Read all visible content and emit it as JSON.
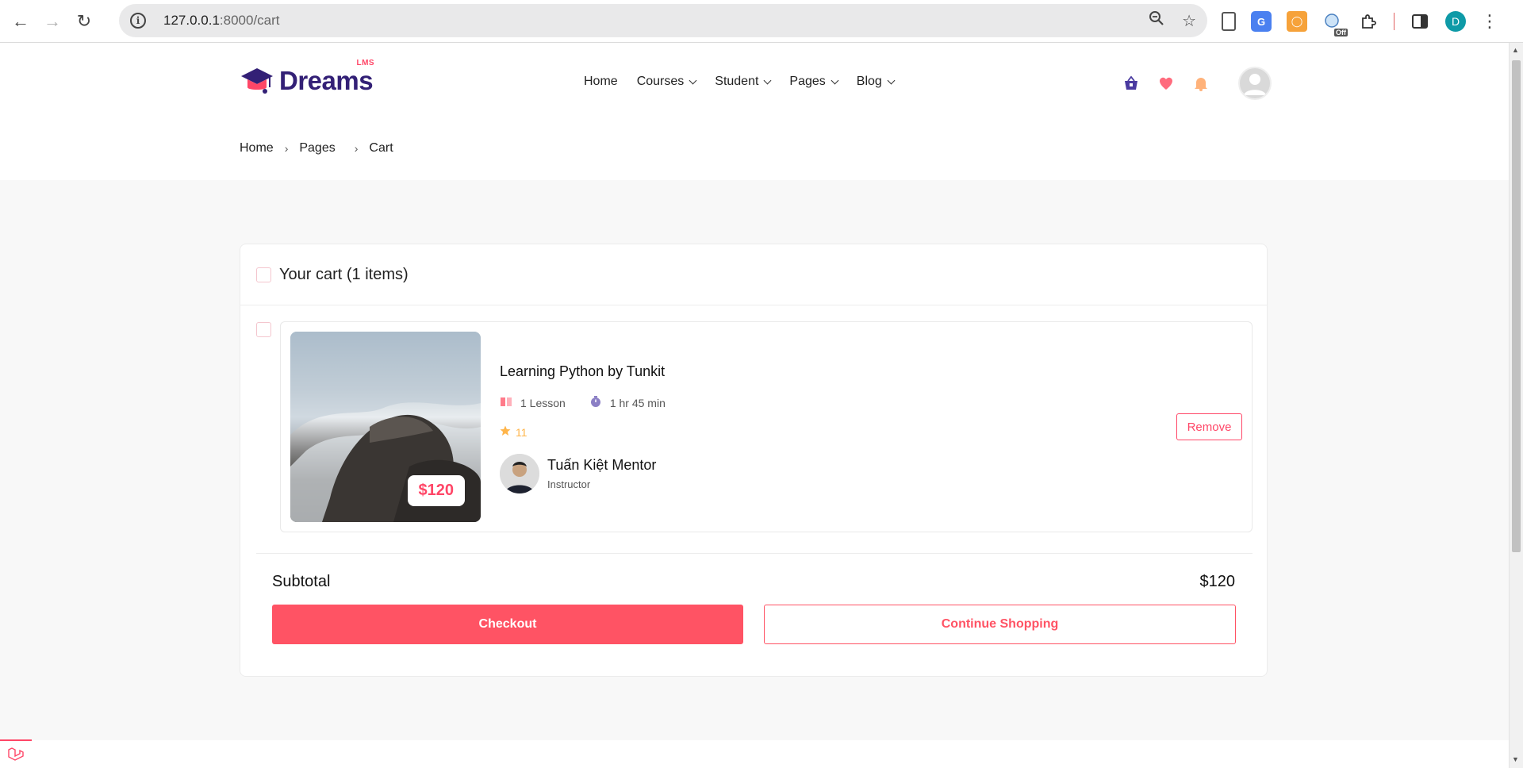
{
  "browser": {
    "url_host": "127.0.0.1",
    "url_rest": ":8000/cart",
    "profile_initial": "D",
    "extension_badge": "Off"
  },
  "site": {
    "logo_text": "Dreams",
    "logo_badge": "LMS",
    "nav": [
      {
        "label": "Home",
        "has_dropdown": false
      },
      {
        "label": "Courses",
        "has_dropdown": true
      },
      {
        "label": "Student",
        "has_dropdown": true
      },
      {
        "label": "Pages",
        "has_dropdown": true
      },
      {
        "label": "Blog",
        "has_dropdown": true
      }
    ],
    "header_icons": [
      "cart-icon",
      "wishlist-heart-icon",
      "notification-bell-icon"
    ],
    "accent_color": "#ff4667",
    "brand_color": "#332076"
  },
  "breadcrumb": [
    "Home",
    "Pages",
    "Cart"
  ],
  "cart": {
    "title": "Your cart (1 items)",
    "items": [
      {
        "title": "Learning Python by Tunkit",
        "price": "$120",
        "lessons": "1 Lesson",
        "duration": "1 hr 45 min",
        "rating": "11",
        "instructor_name": "Tuấn Kiệt Mentor",
        "instructor_role": "Instructor",
        "remove_label": "Remove"
      }
    ],
    "subtotal_label": "Subtotal",
    "subtotal_value": "$120",
    "checkout_label": "Checkout",
    "continue_label": "Continue Shopping"
  }
}
